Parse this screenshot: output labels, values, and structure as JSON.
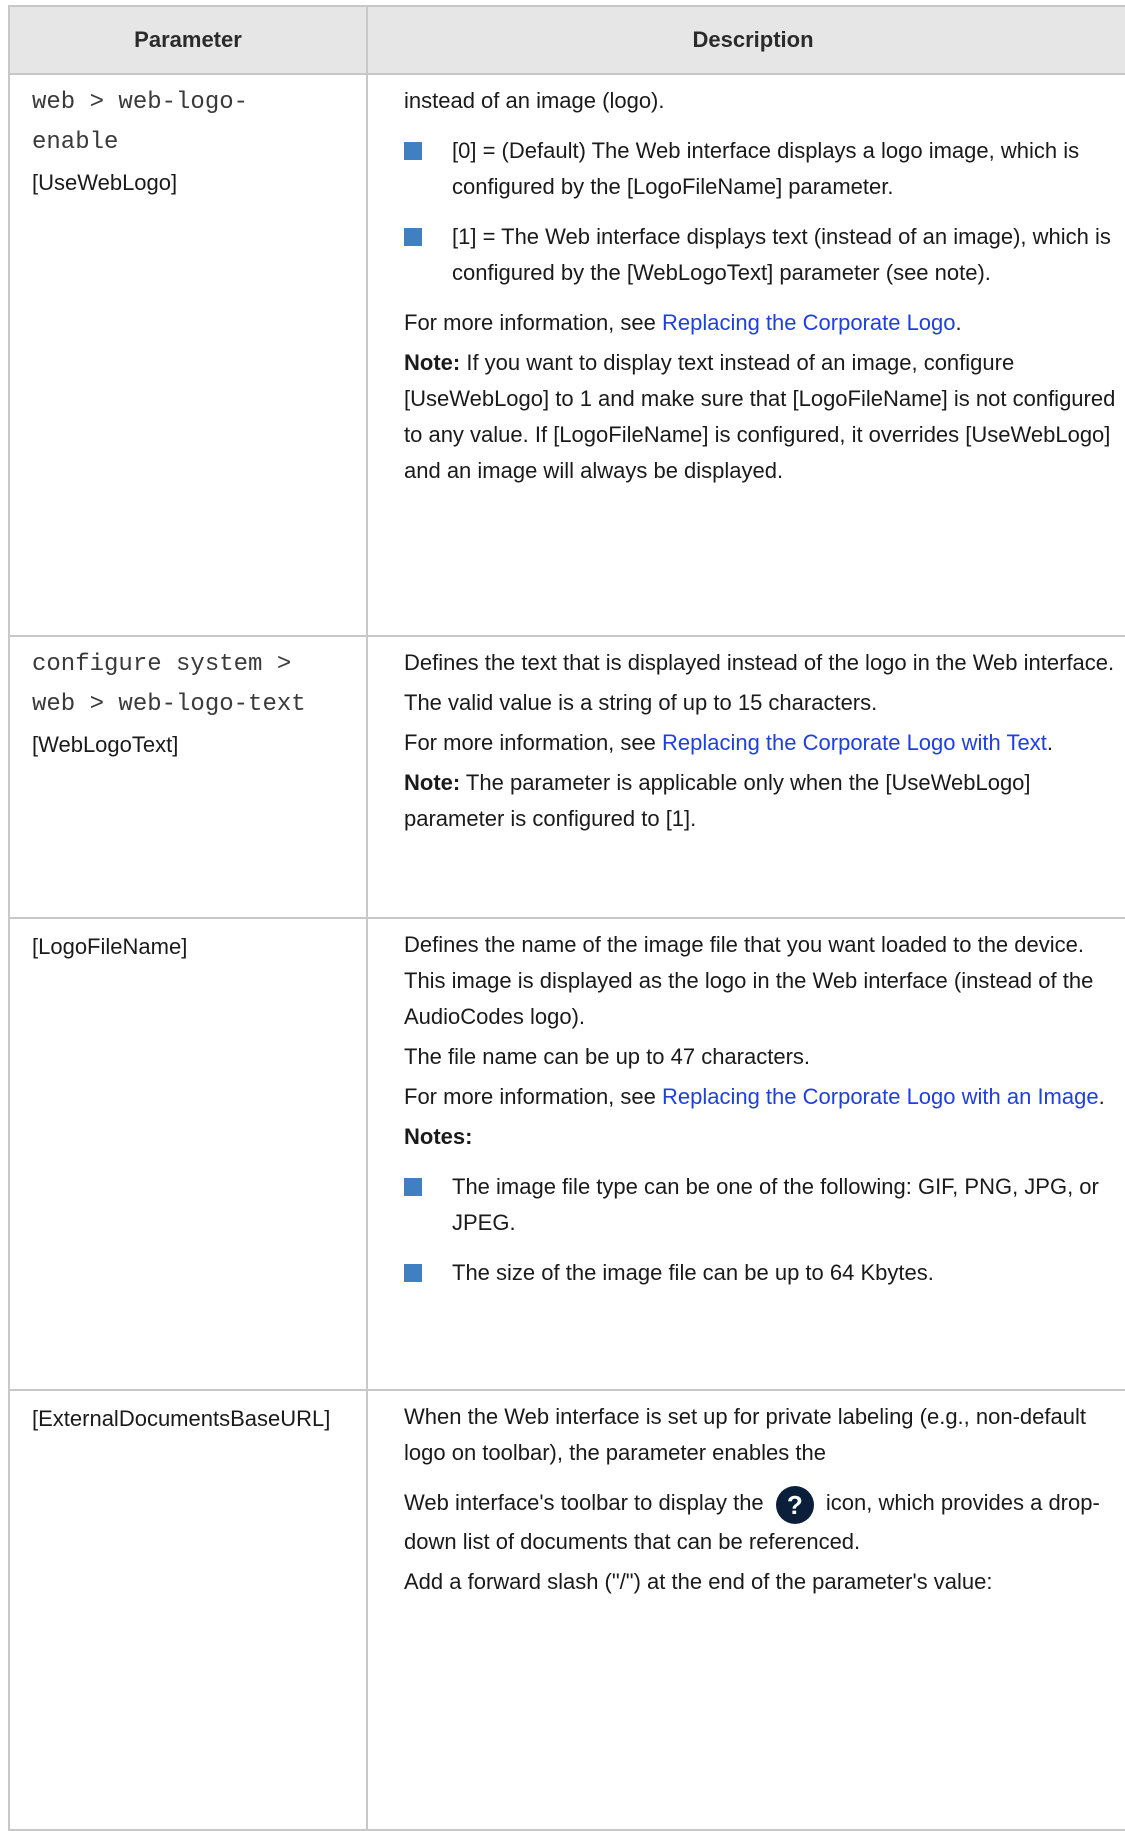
{
  "headers": {
    "parameter": "Parameter",
    "description": "Description"
  },
  "rows": [
    {
      "cli": [
        "web > web-logo-",
        "enable"
      ],
      "param": "[UseWebLogo]",
      "intro": "instead of an image (logo).",
      "bullet1": "[0] = (Default) The Web interface displays a logo image, which is configured by the [LogoFileName] parameter.",
      "bullet2": "[1] = The Web interface displays text (instead of an image), which is configured by the [WebLogoText] parameter (see note).",
      "more_prefix": "For more information, see ",
      "more_link": "Replacing the Corporate Logo",
      "more_suffix": ".",
      "note_label": "Note:",
      "note_text": " If you want to display text instead of an image, configure [UseWebLogo] to 1 and make sure that [LogoFileName] is not configured to any value. If [LogoFileName] is configured, it overrides [UseWebLogo] and an image will always be displayed."
    },
    {
      "cli": [
        "configure system >",
        "web > web-logo-text"
      ],
      "param": "[WebLogoText]",
      "line1": "Defines the text that is displayed instead of the logo in the Web interface.",
      "line2": "The valid value is a string of up to 15 characters.",
      "more_prefix": "For more information, see ",
      "more_link": "Replacing the Corporate Logo with Text",
      "more_suffix": ".",
      "note_label": "Note:",
      "note_text": " The parameter is applicable only when the [UseWebLogo] parameter is configured to [1]."
    },
    {
      "param": "[LogoFileName]",
      "line1": "Defines the name of the image file that you want loaded to the device. This image is displayed as the logo in the Web interface (instead of the AudioCodes logo).",
      "line2": "The file name can be up to 47 characters.",
      "more_prefix": "For more information, see ",
      "more_link": "Replacing the Corporate Logo with an Image",
      "more_suffix": ".",
      "notes_label": "Notes:",
      "bullet1": "The image file type can be one of the following: GIF, PNG, JPG, or JPEG.",
      "bullet2": "The size of the image file can be up to 64 Kbytes."
    },
    {
      "param": "[ExternalDocumentsBaseURL]",
      "line1": "When the Web interface is set up for private labeling (e.g., non-default logo on toolbar), the parameter enables the",
      "line2_pre": "Web interface's toolbar to display the ",
      "icon_glyph": "?",
      "line2_post": " icon, which provides a drop-down list of documents that can be referenced.",
      "line3": "Add a forward slash (\"/\") at the end of the parameter's value:"
    }
  ]
}
